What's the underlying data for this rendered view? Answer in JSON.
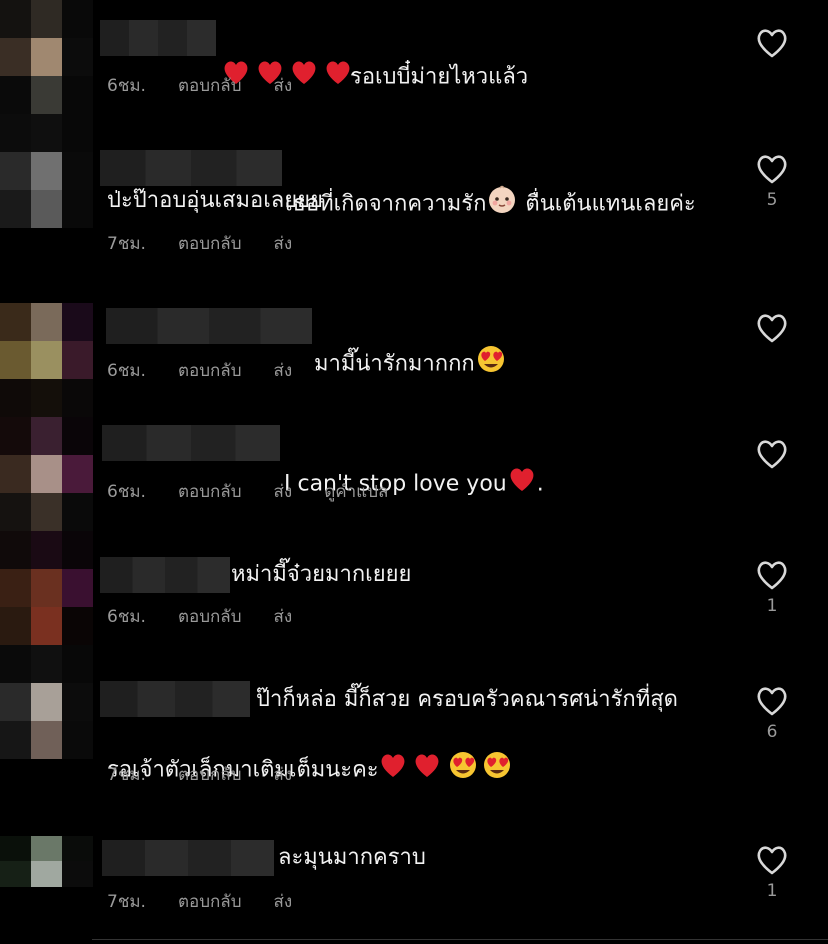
{
  "actions": {
    "reply": "ตอบกลับ",
    "send": "ส่ง",
    "translate": "ดูคำแปล"
  },
  "comments": [
    {
      "text": "รอเบบี๋ม่ายไหวแล้ว",
      "time": "6ชม.",
      "likes": ""
    },
    {
      "text": "เธอที่เกิดจากความรัก",
      "text_b": "ตื่นเต้นแทนเลยค่ะ",
      "line2": "ป่ะป๊าอบอุ่นเสมอเลยยย",
      "time": "7ชม.",
      "likes": "5"
    },
    {
      "text": "มามี๊น่ารักมากกก",
      "time": "6ชม.",
      "likes": ""
    },
    {
      "text": "I can't stop love you",
      "text_b": ".",
      "time": "6ชม.",
      "likes": ""
    },
    {
      "text": "หม่ามี๊จ๋วยมากเยยย",
      "time": "6ชม.",
      "likes": "1"
    },
    {
      "text": "ป๊าก็หล่อ มี๊ก็สวย ครอบครัวคณารศน่ารักที่สุด",
      "line2": "รอเจ้าตัวเล็กมาเติมเต็มนะคะ",
      "time": "7ชม.",
      "likes": "6"
    },
    {
      "text": "ละมุนมากคราบ",
      "time": "7ชม.",
      "likes": "1"
    }
  ],
  "icons": {
    "like": "heart-outline-icon",
    "heart": "red-heart-emoji",
    "love_eyes": "heart-eyes-emoji",
    "baby": "baby-emoji"
  }
}
